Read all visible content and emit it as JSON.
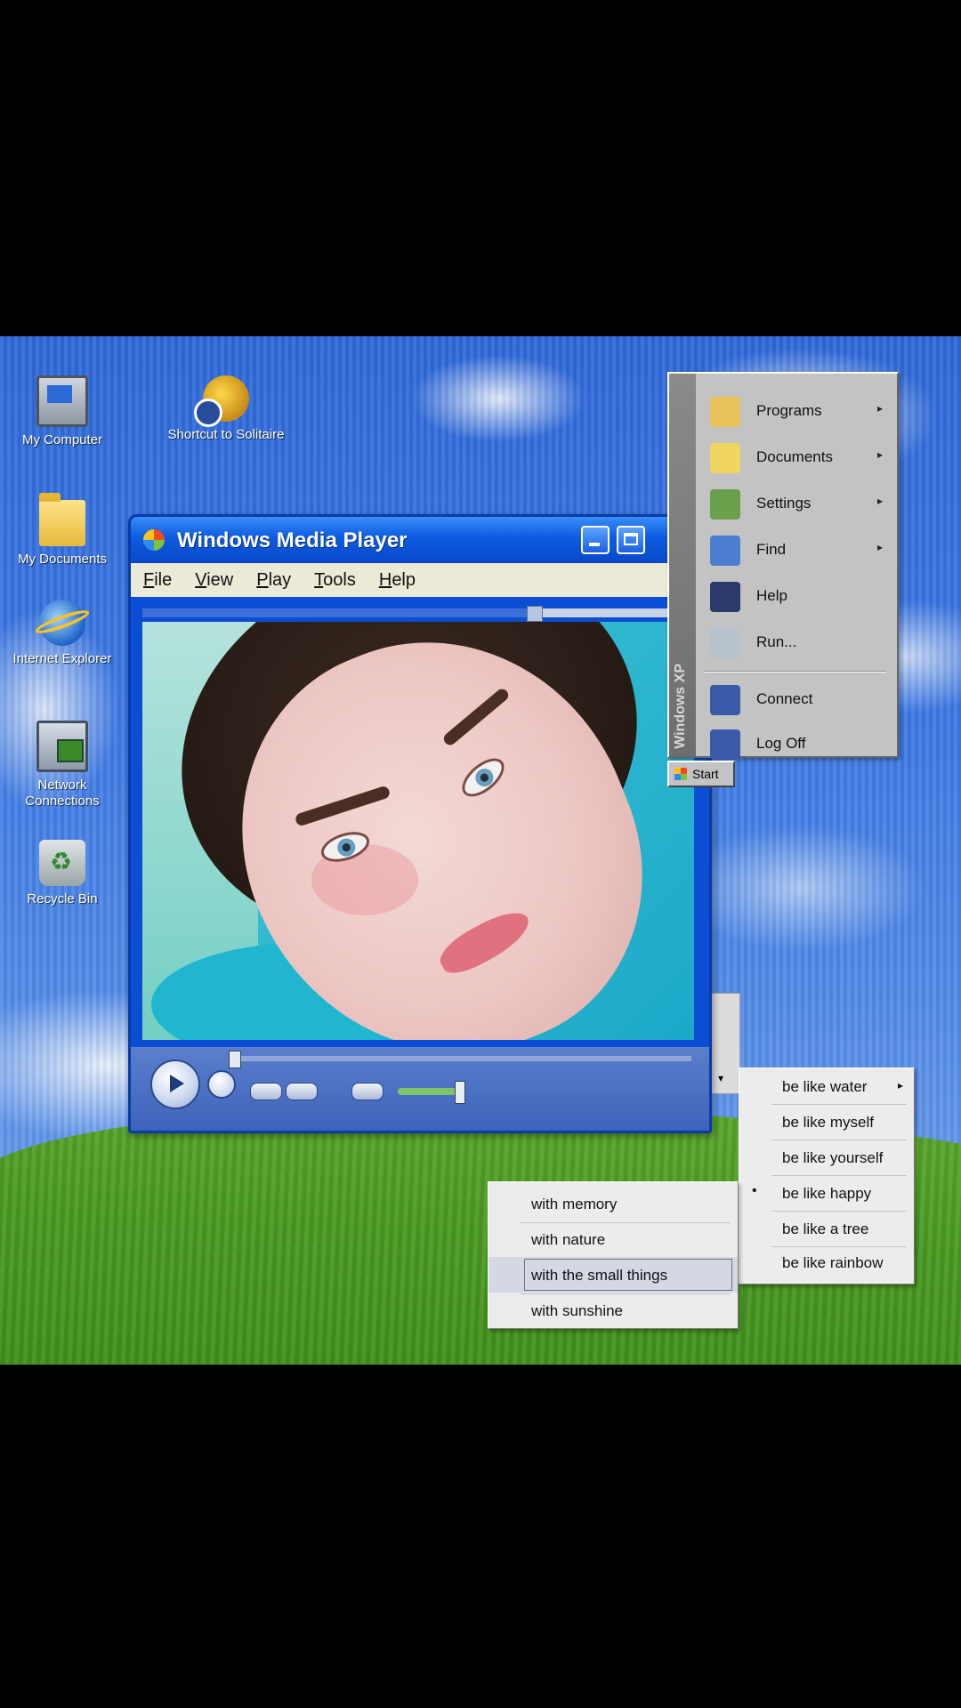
{
  "desktop": {
    "icons": [
      {
        "label": "My Computer",
        "icon": "computer-icon"
      },
      {
        "label": "Shortcut to Solitaire",
        "icon": "shortcut-icon"
      },
      {
        "label": "My Documents",
        "icon": "folder-icon"
      },
      {
        "label": "Internet Explorer",
        "icon": "internet-explorer-icon"
      },
      {
        "label": "Network Connections",
        "icon": "network-icon"
      },
      {
        "label": "Recycle Bin",
        "icon": "recycle-bin-icon"
      }
    ]
  },
  "player": {
    "title": "Windows Media Player",
    "menu": [
      "File",
      "View",
      "Play",
      "Tools",
      "Help"
    ],
    "minimize_symbol": "_",
    "seek_fraction": 0.71,
    "volume_fraction": 0.9
  },
  "start_menu": {
    "side_label": "Windows XP",
    "items": [
      {
        "label": "Programs",
        "icon": "programs-icon",
        "submenu": true,
        "color": "#e8c35a"
      },
      {
        "label": "Documents",
        "icon": "documents-icon",
        "submenu": true,
        "color": "#f0d460"
      },
      {
        "label": "Settings",
        "icon": "settings-icon",
        "submenu": true,
        "color": "#6aa04c"
      },
      {
        "label": "Find",
        "icon": "find-icon",
        "submenu": true,
        "color": "#4c7ed0"
      },
      {
        "label": "Help",
        "icon": "help-icon",
        "submenu": false,
        "color": "#2a3a6a"
      },
      {
        "label": "Run...",
        "icon": "run-icon",
        "submenu": false,
        "color": "#b8c2cc"
      },
      {
        "label": "Connect",
        "icon": "connect-icon",
        "submenu": false,
        "color": "#3a5aa8"
      },
      {
        "label": "Log Off",
        "icon": "logoff-icon",
        "submenu": false,
        "color": "#3a5aa8"
      }
    ],
    "taskbar_label": "Start"
  },
  "menu_be": {
    "items": [
      {
        "label": "be like water",
        "submenu": true
      },
      {
        "label": "be like myself",
        "submenu": false
      },
      {
        "label": "be like yourself",
        "submenu": false
      },
      {
        "label": "be like happy",
        "submenu": false,
        "checked": true
      },
      {
        "label": "be like a tree",
        "submenu": false
      },
      {
        "label": "be like rainbow",
        "submenu": false
      }
    ],
    "check_glyph": "•",
    "arrow_glyph": "▸"
  },
  "menu_with": {
    "items": [
      {
        "label": "with memory",
        "highlighted": false
      },
      {
        "label": "with nature",
        "highlighted": false
      },
      {
        "label": "with the small things",
        "highlighted": true
      },
      {
        "label": "with sunshine",
        "highlighted": false
      }
    ]
  }
}
